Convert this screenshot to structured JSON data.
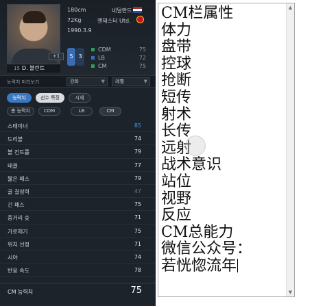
{
  "player": {
    "height": "180cm",
    "weight": "72Kg",
    "birth": "1990.3.9",
    "nation": "네덜란드",
    "club": "맨체스터 Utd.",
    "name": "D. 블린트",
    "number": "15",
    "photo_badge": "+1",
    "ovr_left": "5",
    "ovr_right": "3"
  },
  "positions": [
    {
      "name": "CDM",
      "value": "75",
      "color": "#2f9e5a"
    },
    {
      "name": "LB",
      "value": "72",
      "color": "#3a6bb5"
    },
    {
      "name": "CM",
      "value": "75",
      "color": "#2f9e5a"
    }
  ],
  "preview": {
    "label": "능력치 미리보기",
    "enhance": "강화",
    "level": "레벨"
  },
  "tabs": [
    "능력치",
    "선수 특징",
    "시세"
  ],
  "pos_tabs": [
    "총 능력치",
    "CDM",
    "LB",
    "CM"
  ],
  "stats": [
    {
      "name": "스태미너",
      "value": "85",
      "style": "hi"
    },
    {
      "name": "드리블",
      "value": "74",
      "style": ""
    },
    {
      "name": "볼 컨트롤",
      "value": "79",
      "style": ""
    },
    {
      "name": "태클",
      "value": "77",
      "style": ""
    },
    {
      "name": "짧은 패스",
      "value": "79",
      "style": ""
    },
    {
      "name": "골 결정력",
      "value": "47",
      "style": "lo"
    },
    {
      "name": "긴 패스",
      "value": "75",
      "style": ""
    },
    {
      "name": "중거리 슛",
      "value": "71",
      "style": ""
    },
    {
      "name": "가로채기",
      "value": "75",
      "style": ""
    },
    {
      "name": "위치 선정",
      "value": "71",
      "style": ""
    },
    {
      "name": "시야",
      "value": "74",
      "style": ""
    },
    {
      "name": "반응 속도",
      "value": "78",
      "style": ""
    }
  ],
  "total": {
    "label": "CM 능력치",
    "value": "75"
  },
  "editor": {
    "lines": [
      "CM栏属性",
      "体力",
      "盘带",
      "控球",
      "抢断",
      "短传",
      "射术",
      "长传",
      "远射",
      "战术意识",
      "站位",
      "视野",
      "反应",
      "CM总能力",
      "微信公众号：",
      "若恍惚流年"
    ]
  }
}
